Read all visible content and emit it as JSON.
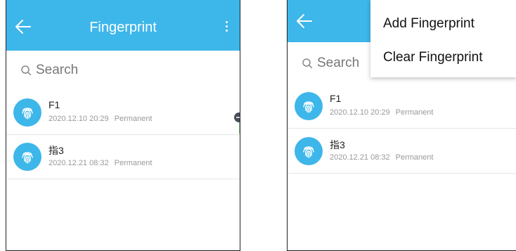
{
  "left_screen": {
    "title": "Fingerprint",
    "search_placeholder": "Search",
    "items": [
      {
        "name": "F1",
        "datetime": "2020.12.10 20:29",
        "validity": "Permanent"
      },
      {
        "name": "指3",
        "datetime": "2020.12.21 08:32",
        "validity": "Permanent"
      }
    ]
  },
  "right_screen": {
    "search_placeholder": "Search",
    "menu": {
      "items": [
        "Add Fingerprint",
        "Clear Fingerprint"
      ]
    },
    "items": [
      {
        "name": "F1",
        "datetime": "2020.12.10 20:29",
        "validity": "Permanent"
      },
      {
        "name": "指3",
        "datetime": "2020.12.21 08:32",
        "validity": "Permanent"
      }
    ]
  },
  "colors": {
    "accent": "#3db6ea",
    "text_primary": "#222222",
    "text_secondary": "#999999"
  },
  "icons": [
    "back-arrow-icon",
    "more-vertical-icon",
    "search-icon",
    "fingerprint-icon"
  ]
}
